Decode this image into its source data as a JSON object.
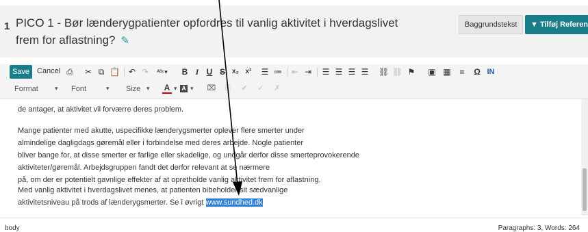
{
  "header": {
    "number": "1",
    "title": "PICO 1 - Bør lænderygpatienter opfordres til vanlig aktivitet i hverdagslivet frem for aflastning?",
    "background_button": "Baggrundstekst",
    "add_reference_button": "▼ Tilføj Referen",
    "pencil_icon": "pencil-icon"
  },
  "toolbar": {
    "save_label": "Save",
    "cancel_label": "Cancel",
    "format_label": "Format",
    "font_label": "Font",
    "size_label": "Size",
    "icons": [
      "print-icon",
      "cut-icon",
      "copy-icon",
      "paste-icon",
      "undo-icon",
      "redo-icon",
      "spellcheck-icon",
      "bold-icon",
      "italic-icon",
      "underline-icon",
      "strikethrough-icon",
      "subscript-icon",
      "superscript-icon",
      "numbered-list-icon",
      "bullet-list-icon",
      "outdent-icon",
      "indent-icon",
      "align-left-icon",
      "align-center-icon",
      "align-right-icon",
      "justify-icon",
      "link-icon",
      "unlink-icon",
      "anchor-icon",
      "image-icon",
      "table-icon",
      "horizontal-rule-icon",
      "special-char-icon",
      "library-icon"
    ]
  },
  "content": {
    "lines": [
      "de antager, at aktivitet vil forværre deres problem.",
      "",
      "Mange patienter med akutte, uspecifikke lænderygsmerter oplever flere smerter under",
      "almindelige dagligdags gøremål eller i forbindelse med deres arbejde. Nogle patienter",
      "bliver bange for, at disse smerter er farlige eller skadelige, og undgår derfor disse smerteprovokerende",
      "aktiviteter/gøremål. Arbejdsgruppen fandt det derfor relevant at se nærmere",
      "på, om der er potentielt gavnlige effekter af at opretholde vanlig aktivitet frem for aflastning.",
      "Med vanlig aktivitet i hverdagslivet menes, at patienten bibeholder sit sædvanlige"
    ],
    "last_line_prefix": "aktivitetsniveau på trods af lænderygsmerter. Se i øvrigt ",
    "link_text": "www.sundhed.dk"
  },
  "status": {
    "path": "body",
    "counts": "Paragraphs: 3, Words: 264"
  },
  "colors": {
    "accent": "#1a7e8a",
    "selection": "#2e7fd9",
    "header_bg": "#f2f2f2"
  }
}
